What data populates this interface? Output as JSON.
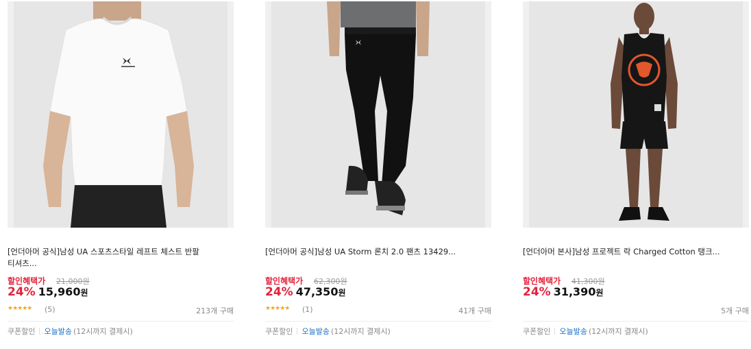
{
  "products": [
    {
      "title_line1": "[언더아머 공식]남성 UA 스포츠스타일 레프트 체스트 반팔",
      "title_line2": "티셔츠...",
      "discount_label": "할인혜택가",
      "original_price": "21,000원",
      "discount_rate": "24%",
      "price": "15,960",
      "currency": "원",
      "stars": "★★★★★",
      "review_count": "(5)",
      "purchase_count": "213개 구매",
      "coupon_label": "쿠폰할인",
      "shipping_label": "오늘발송",
      "shipping_note": "(12시까지 결제시)",
      "icon": "tshirt-image"
    },
    {
      "title_line1": "[언더아머 공식]남성 UA Storm 론치 2.0 팬츠 13429...",
      "title_line2": "",
      "discount_label": "할인혜택가",
      "original_price": "62,300원",
      "discount_rate": "24%",
      "price": "47,350",
      "currency": "원",
      "stars": "★★★★★",
      "review_count": "(1)",
      "purchase_count": "41개 구매",
      "coupon_label": "쿠폰할인",
      "shipping_label": "오늘발송",
      "shipping_note": "(12시까지 결제시)",
      "icon": "pants-image"
    },
    {
      "title_line1": "[언더아머 본사]남성 프로젝트 락 Charged Cotton 탱크...",
      "title_line2": "",
      "discount_label": "할인혜택가",
      "original_price": "41,300원",
      "discount_rate": "24%",
      "price": "31,390",
      "currency": "원",
      "stars": "",
      "review_count": "",
      "purchase_count": "5개 구매",
      "coupon_label": "쿠폰할인",
      "shipping_label": "오늘발송",
      "shipping_note": "(12시까지 결제시)",
      "icon": "tank-top-image"
    }
  ],
  "colors": {
    "discount_red": "#e3213b",
    "shipping_blue": "#1a6fc9",
    "star_orange": "#f5a623"
  }
}
